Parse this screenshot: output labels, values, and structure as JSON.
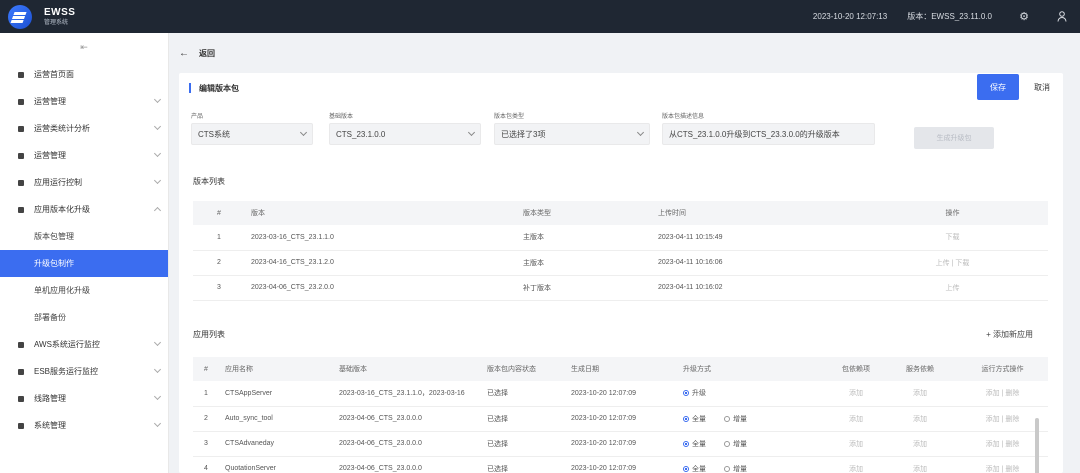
{
  "app": {
    "name": "EWSS",
    "subtitle": "管理系统",
    "datetime": "2023-10-20 12:07:13",
    "version_label": "版本：",
    "version": "EWSS_23.11.0.0"
  },
  "icons": {
    "settings": "gear-icon",
    "user": "user-icon",
    "collapse": "collapse-icon",
    "back": "arrow-left-icon"
  },
  "colors": {
    "accent": "#3b6df0",
    "topbar": "#1f2733"
  },
  "sidebar": {
    "collapse_glyph": "⇤",
    "items": [
      {
        "label": "运营首页面",
        "chevron": false
      },
      {
        "label": "运营管理",
        "chevron": true
      },
      {
        "label": "运营类统计分析",
        "chevron": true
      },
      {
        "label": "运营管理",
        "chevron": true
      },
      {
        "label": "应用运行控制",
        "chevron": true
      },
      {
        "label": "应用版本化升级",
        "chevron": true,
        "open": true
      }
    ],
    "subitems": [
      {
        "label": "版本包管理",
        "active": false
      },
      {
        "label": "升级包制作",
        "active": true
      },
      {
        "label": "单机应用化升级",
        "active": false
      },
      {
        "label": "部署备份",
        "active": false
      }
    ],
    "items_after": [
      {
        "label": "AWS系统运行监控",
        "chevron": true
      },
      {
        "label": "ESB服务运行监控",
        "chevron": true
      },
      {
        "label": "线路管理",
        "chevron": true
      },
      {
        "label": "系统管理",
        "chevron": true
      }
    ]
  },
  "main": {
    "back_label": "返回",
    "card_title": "编辑版本包",
    "save_label": "保存",
    "cancel_label": "取消",
    "form": {
      "product_label": "产品",
      "product_value": "CTS系统",
      "version_label": "基础版本",
      "version_value": "CTS_23.1.0.0",
      "upgrade_label": "版本包类型",
      "upgrade_value": "已选择了3项",
      "desc_label": "版本包描述信息",
      "desc_value": "从CTS_23.1.0.0升级到CTS_23.3.0.0的升级版本",
      "generate_label": "生成升级包"
    },
    "version_list_title": "版本列表",
    "version_table": {
      "headers": [
        "#",
        "版本",
        "版本类型",
        "上传时间",
        "操作"
      ],
      "rows": [
        {
          "idx": "1",
          "name": "2023-03-16_CTS_23.1.1.0",
          "type": "主版本",
          "time": "2023-04-11 10:15:49",
          "op": "下载"
        },
        {
          "idx": "2",
          "name": "2023-04-16_CTS_23.1.2.0",
          "type": "主版本",
          "time": "2023-04-11 10:16:06",
          "op": "上传 | 下载"
        },
        {
          "idx": "3",
          "name": "2023-04-06_CTS_23.2.0.0",
          "type": "补丁版本",
          "time": "2023-04-11 10:16:02",
          "op": "上传"
        }
      ]
    },
    "app_list_title": "应用列表",
    "add_app_label": "+ 添加新应用",
    "app_table": {
      "headers": [
        "#",
        "应用名称",
        "基础版本",
        "版本包内容状态",
        "生成日期",
        "升级方式",
        "包依赖项",
        "服务依赖",
        "运行方式操作"
      ],
      "rows": [
        {
          "idx": "1",
          "name": "CTSAppServer",
          "ver": "2023-03-16_CTS_23.1.1.0，2023-03-16",
          "state": "已选择",
          "date": "2023-10-20 12:07:09",
          "opt1": "升级",
          "opt2": "",
          "dep": "添加",
          "svc": "添加",
          "run": "添加 | 删除"
        },
        {
          "idx": "2",
          "name": "Auto_sync_tool",
          "ver": "2023-04-06_CTS_23.0.0.0",
          "state": "已选择",
          "date": "2023-10-20 12:07:09",
          "opt1": "全量",
          "opt2": "增量",
          "dep": "添加",
          "svc": "添加",
          "run": "添加 | 删除"
        },
        {
          "idx": "3",
          "name": "CTSAdvaneday",
          "ver": "2023-04-06_CTS_23.0.0.0",
          "state": "已选择",
          "date": "2023-10-20 12:07:09",
          "opt1": "全量",
          "opt2": "增量",
          "dep": "添加",
          "svc": "添加",
          "run": "添加 | 删除"
        },
        {
          "idx": "4",
          "name": "QuotationServer",
          "ver": "2023-04-06_CTS_23.0.0.0",
          "state": "已选择",
          "date": "2023-10-20 12:07:09",
          "opt1": "全量",
          "opt2": "增量",
          "dep": "添加",
          "svc": "添加",
          "run": "添加 | 删除"
        }
      ]
    }
  }
}
